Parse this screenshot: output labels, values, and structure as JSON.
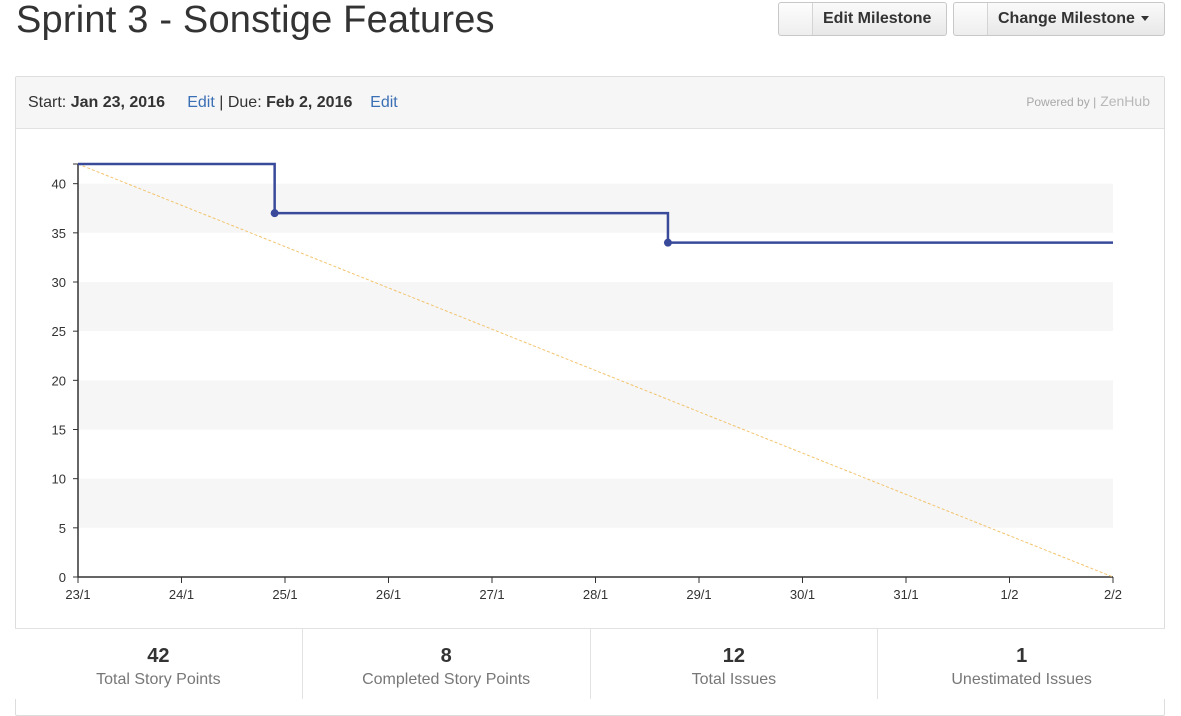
{
  "header": {
    "title": "Sprint 3 - Sonstige Features",
    "edit_milestone_label": "Edit Milestone",
    "change_milestone_label": "Change Milestone"
  },
  "milestone": {
    "start_prefix": "Start: ",
    "start_date": "Jan 23, 2016",
    "edit_label": "Edit",
    "separator": " | Due: ",
    "due_date": "Feb 2, 2016",
    "powered_by": "Powered by |",
    "brand": "ZenHub"
  },
  "chart_data": {
    "type": "line",
    "x": [
      "23/1",
      "24/1",
      "25/1",
      "26/1",
      "27/1",
      "28/1",
      "29/1",
      "30/1",
      "31/1",
      "1/2",
      "2/2"
    ],
    "yticks": [
      0,
      5,
      10,
      15,
      20,
      25,
      30,
      35,
      40
    ],
    "ylim": [
      0,
      42
    ],
    "grid": "alternating horizontal bands",
    "series": [
      {
        "color": "#3a4a9a",
        "points": [
          {
            "x": 0,
            "y": 42
          },
          {
            "x": 1.9,
            "y": 42
          },
          {
            "x": 1.9,
            "y": 37,
            "marker": true
          },
          {
            "x": 5.7,
            "y": 37
          },
          {
            "x": 5.7,
            "y": 34,
            "marker": true
          },
          {
            "x": 10,
            "y": 34
          }
        ]
      },
      {
        "color": "#f2c46e",
        "dashed": true,
        "points": [
          {
            "x": 0,
            "y": 42
          },
          {
            "x": 10,
            "y": 0
          }
        ]
      }
    ]
  },
  "stats": [
    {
      "value": "42",
      "label": "Total Story Points"
    },
    {
      "value": "8",
      "label": "Completed Story Points"
    },
    {
      "value": "12",
      "label": "Total Issues"
    },
    {
      "value": "1",
      "label": "Unestimated Issues"
    }
  ]
}
